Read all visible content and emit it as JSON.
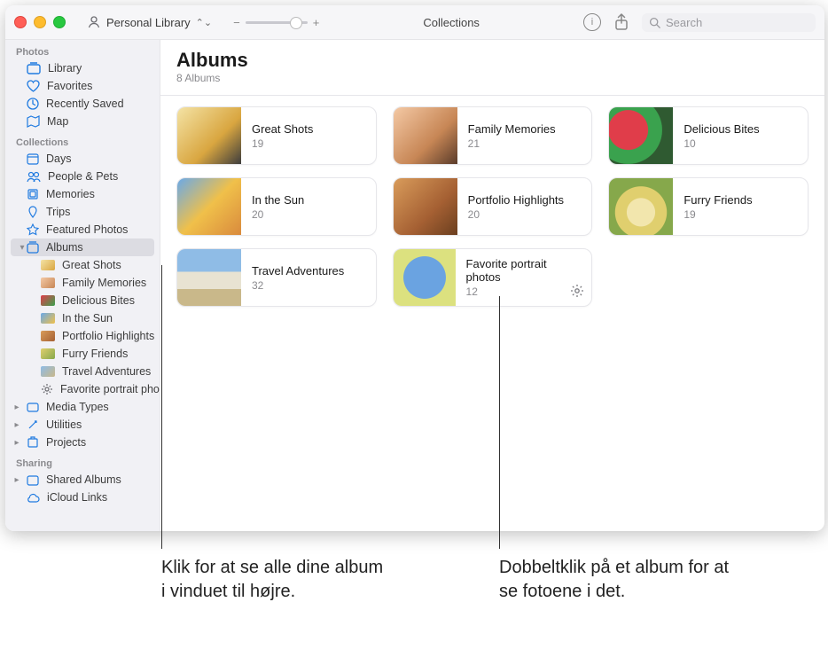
{
  "toolbar": {
    "library_label": "Personal Library",
    "center_label": "Collections",
    "search_placeholder": "Search"
  },
  "header": {
    "title": "Albums",
    "subtitle": "8 Albums"
  },
  "sidebar": {
    "sections": {
      "photos": "Photos",
      "collections": "Collections",
      "sharing": "Sharing"
    },
    "photos_items": {
      "library": "Library",
      "favorites": "Favorites",
      "recently_saved": "Recently Saved",
      "map": "Map"
    },
    "collections_items": {
      "days": "Days",
      "people_pets": "People & Pets",
      "memories": "Memories",
      "trips": "Trips",
      "featured": "Featured Photos",
      "albums": "Albums",
      "media_types": "Media Types",
      "utilities": "Utilities",
      "projects": "Projects"
    },
    "album_children": {
      "a": "Great Shots",
      "b": "Family Memories",
      "c": "Delicious Bites",
      "d": "In the Sun",
      "e": "Portfolio Highlights",
      "f": "Furry Friends",
      "g": "Travel Adventures",
      "h": "Favorite portrait photos"
    },
    "sharing_items": {
      "shared_albums": "Shared Albums",
      "icloud_links": "iCloud Links"
    }
  },
  "albums": [
    {
      "name": "Great Shots",
      "count": "19"
    },
    {
      "name": "Family Memories",
      "count": "21"
    },
    {
      "name": "Delicious Bites",
      "count": "10"
    },
    {
      "name": "In the Sun",
      "count": "20"
    },
    {
      "name": "Portfolio Highlights",
      "count": "20"
    },
    {
      "name": "Furry Friends",
      "count": "19"
    },
    {
      "name": "Travel Adventures",
      "count": "32"
    },
    {
      "name": "Favorite portrait photos",
      "count": "12"
    }
  ],
  "callouts": {
    "left": "Klik for at se alle dine album i vinduet til højre.",
    "right": "Dobbeltklik på et album for at se fotoene i det."
  }
}
